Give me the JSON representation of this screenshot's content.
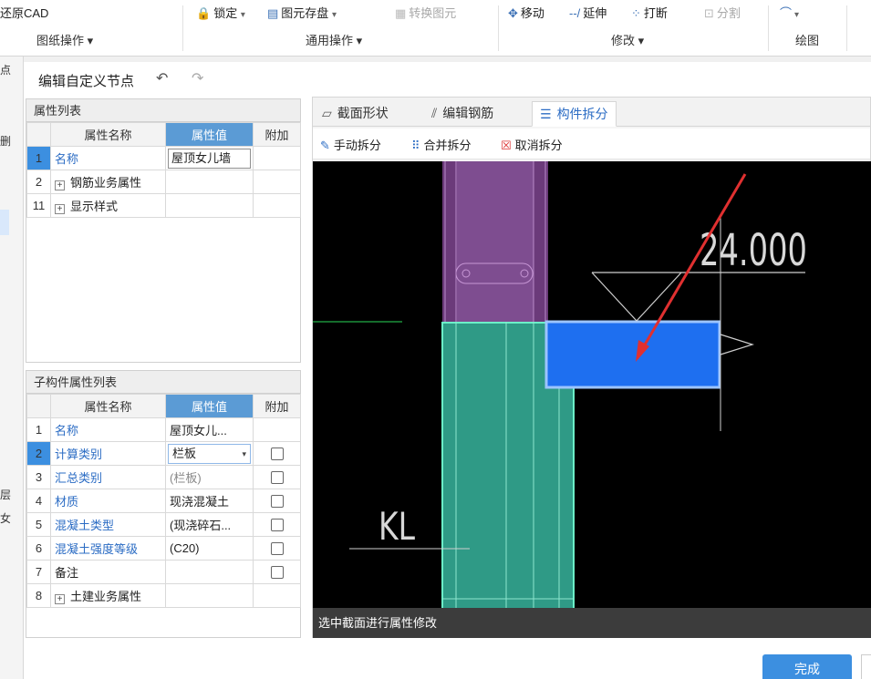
{
  "ribbon": {
    "restore_cad": "还原CAD",
    "drawing_ops_group": "图纸操作 ▾",
    "lock": "锁定",
    "lock_arrow": "▾",
    "save_elements": "图元存盘",
    "save_arrow": "▾",
    "convert_elements": "转换图元",
    "common_ops_group": "通用操作 ▾",
    "move": "移动",
    "extend": "延伸",
    "break": "打断",
    "split": "分割",
    "modify_group": "修改 ▾",
    "draw_group": "绘图"
  },
  "underlay": {
    "t1": "点",
    "t2": "删",
    "t3": "层",
    "t4": "女"
  },
  "dialog": {
    "title": "编辑自定义节点",
    "undo": "↶",
    "redo": "↷",
    "prop_panel": {
      "header": "属性列表",
      "columns": [
        "属性名称",
        "属性值",
        "附加"
      ],
      "rows": [
        {
          "num": "1",
          "name": "名称",
          "value": "屋顶女儿墙"
        },
        {
          "num": "2",
          "name": "钢筋业务属性",
          "value": ""
        },
        {
          "num": "11",
          "name": "显示样式",
          "value": ""
        }
      ]
    },
    "sub_panel": {
      "header": "子构件属性列表",
      "columns": [
        "属性名称",
        "属性值",
        "附加"
      ],
      "rows": [
        {
          "num": "1",
          "name": "名称",
          "value": "屋顶女儿..."
        },
        {
          "num": "2",
          "name": "计算类别",
          "value": "栏板",
          "arrow": "▾"
        },
        {
          "num": "3",
          "name": "汇总类别",
          "value": "(栏板)"
        },
        {
          "num": "4",
          "name": "材质",
          "value": "现浇混凝土"
        },
        {
          "num": "5",
          "name": "混凝土类型",
          "value": "(现浇碎石..."
        },
        {
          "num": "6",
          "name": "混凝土强度等级",
          "value": "(C20)"
        },
        {
          "num": "7",
          "name": "备注",
          "value": ""
        },
        {
          "num": "8",
          "name": "土建业务属性",
          "value": ""
        }
      ]
    },
    "tabs": [
      "截面形状",
      "编辑钢筋",
      "构件拆分"
    ],
    "toolbar": [
      "手动拆分",
      "合并拆分",
      "取消拆分"
    ],
    "canvas": {
      "elevation_label": "24.000",
      "beam_label": "KL"
    },
    "status_text": "选中截面进行属性修改",
    "done_button": "完成"
  },
  "colors": {
    "accent": "#3c8fe0",
    "canvas_bg": "#000000",
    "wall_purple": "#8a4a9a",
    "column_green": "#2f9a86",
    "slab_blue": "#1e6ff0",
    "arrow_red": "#e03030"
  }
}
